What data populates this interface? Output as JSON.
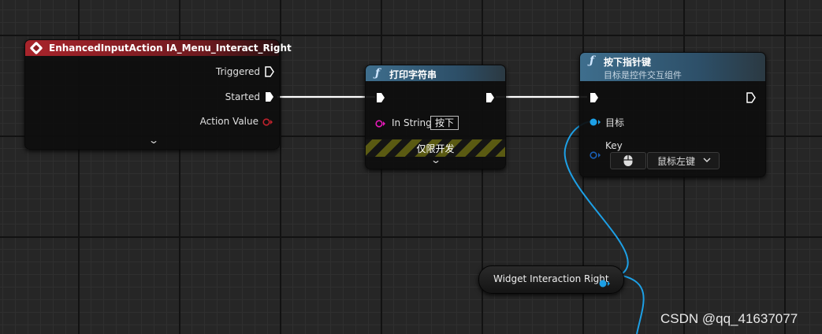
{
  "event_node": {
    "title": "EnhancedInputAction IA_Menu_Interact_Right",
    "pins": {
      "triggered": "Triggered",
      "started": "Started",
      "action_value": "Action Value"
    }
  },
  "print_node": {
    "title": "打印字符串",
    "in_string_label": "In String",
    "in_string_value": "按下",
    "dev_only_label": "仅限开发"
  },
  "press_node": {
    "title": "按下指针键",
    "subtitle": "目标是控件交互组件",
    "target_label": "目标",
    "key_label": "Key",
    "key_value": "鼠标左键"
  },
  "variable_node": {
    "label": "Widget Interaction Right"
  },
  "watermark": "CSDN @qq_41637077",
  "colors": {
    "event_header": "#a8242b",
    "function_header": "#3e6e8d",
    "object_pin": "#1da0e6",
    "string_pin": "#e51ab8",
    "struct_pin": "#c0222c",
    "exec_wire": "#ffffff"
  },
  "icons": [
    "event-diamond-icon",
    "function-icon",
    "exec-pin-icon",
    "chevron-down-icon",
    "mouse-icon"
  ]
}
